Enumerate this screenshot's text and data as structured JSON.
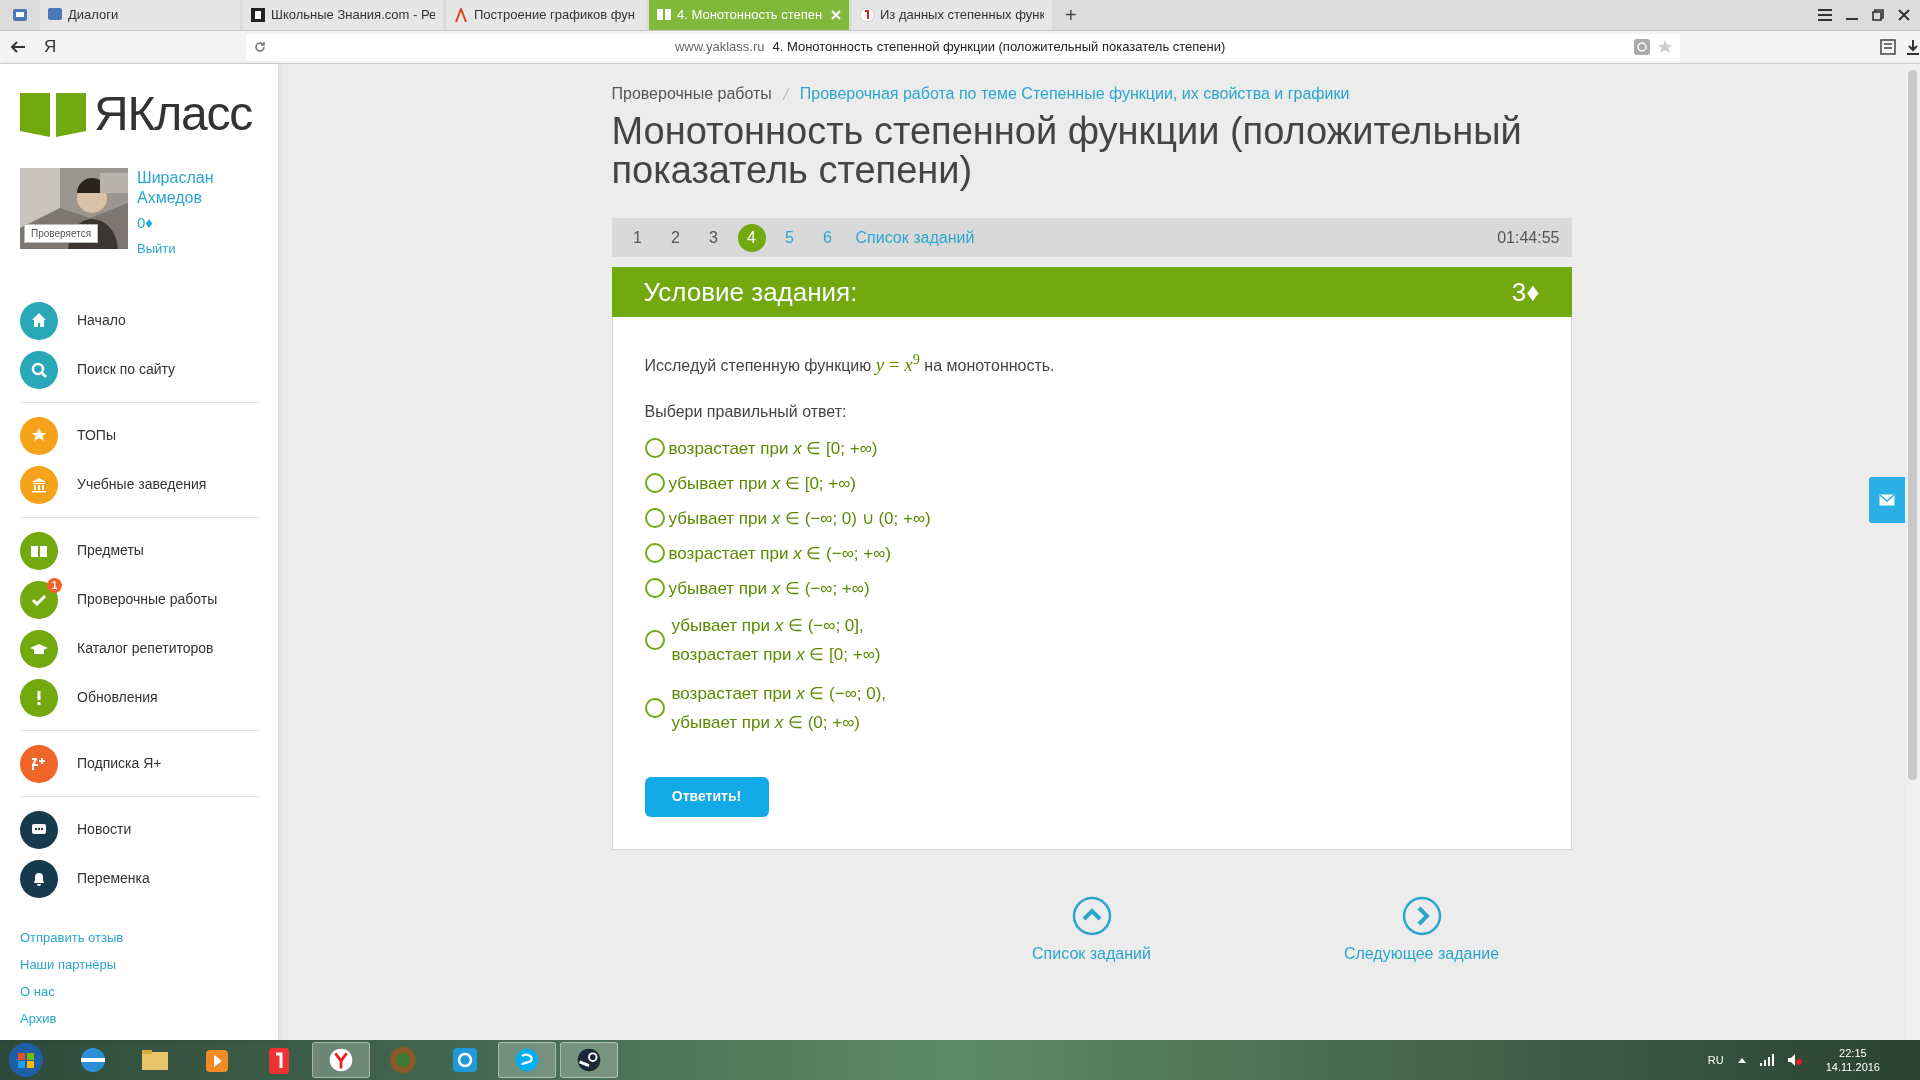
{
  "browser": {
    "tabs": [
      {
        "title": "Диалоги",
        "selected": false
      },
      {
        "title": "Школьные Знания.com - Ре",
        "selected": false
      },
      {
        "title": "Построение графиков фун",
        "selected": false
      },
      {
        "title": "4. Монотонность степен",
        "selected": true
      },
      {
        "title": "Из данных степенных функ",
        "selected": false
      }
    ],
    "new_tab": "+",
    "search_logo": "Я",
    "address_host": "www.yaklass.ru",
    "address_title": "4. Монотонность степенной функции (положительный показатель степени)"
  },
  "sidebar": {
    "logo": "ЯКласс",
    "user": {
      "name": "Шираслан Ахмедов",
      "balance": "0♦",
      "photo_label": "Проверяется",
      "logout": "Выйти"
    },
    "groups": [
      [
        {
          "label": "Начало",
          "color": "#29a8b8"
        },
        {
          "label": "Поиск по сайту",
          "color": "#29a8b8"
        }
      ],
      [
        {
          "label": "ТОПы",
          "color": "#f5a31a"
        },
        {
          "label": "Учебные заведения",
          "color": "#f5a31a"
        }
      ],
      [
        {
          "label": "Предметы",
          "color": "#72a90f"
        },
        {
          "label": "Проверочные работы",
          "color": "#72a90f",
          "badge": "1"
        },
        {
          "label": "Каталог репетиторов",
          "color": "#72a90f"
        },
        {
          "label": "Обновления",
          "color": "#72a90f"
        }
      ],
      [
        {
          "label": "Подписка Я+",
          "color": "#f0642a"
        }
      ],
      [
        {
          "label": "Новости",
          "color": "#173a4f"
        },
        {
          "label": "Переменка",
          "color": "#173a4f"
        }
      ]
    ],
    "footer_links": [
      "Отправить отзыв",
      "Наши партнёры",
      "О нас",
      "Архив"
    ]
  },
  "breadcrumb": [
    "Проверочные работы",
    "Проверочная работа по теме Степенные функции, их свойства и графики"
  ],
  "title": "Монотонность степенной функции (положительный показатель степени)",
  "pager": {
    "pages": [
      {
        "label": "1",
        "selected": false,
        "done": true
      },
      {
        "label": "2",
        "selected": false,
        "done": true
      },
      {
        "label": "3",
        "selected": false,
        "done": true
      },
      {
        "label": "4",
        "selected": true,
        "done": false
      },
      {
        "label": "5",
        "selected": false,
        "done": false
      },
      {
        "label": "6",
        "selected": false,
        "done": false
      }
    ],
    "task_list": "Список заданий",
    "timer": "01:44:55"
  },
  "task": {
    "header": "Условие задания:",
    "points": "3♦",
    "question_before": "Исследуй степенную функцию",
    "question_formula": "*y* = *x*$^{9}$",
    "question_after": "на монотонность.",
    "prompt": "Выбери правильный ответ:",
    "options": [
      {
        "lines": [
          "возрастает при *x* ∈ [0; +∞)"
        ],
        "checked": false
      },
      {
        "lines": [
          "убывает при *x* ∈ [0; +∞)"
        ],
        "checked": false
      },
      {
        "lines": [
          "убывает при *x* ∈ (−∞; 0) ∪ (0; +∞)"
        ],
        "checked": false
      },
      {
        "lines": [
          "возрастает при *x* ∈ (−∞; +∞)"
        ],
        "checked": false
      },
      {
        "lines": [
          "убывает при *x* ∈ (−∞; +∞)"
        ],
        "checked": false
      },
      {
        "lines": [
          "убывает при *x* ∈ (−∞; 0],",
          "возрастает при *x* ∈ [0; +∞)"
        ],
        "checked": false
      },
      {
        "lines": [
          "возрастает при *x* ∈ (−∞; 0),",
          "убывает при *x* ∈ (0; +∞)"
        ],
        "checked": false
      }
    ],
    "submit": "Ответить!"
  },
  "bottom_nav": [
    {
      "label": "Список заданий",
      "kind": "up"
    },
    {
      "label": "Следующее задание",
      "kind": "next"
    }
  ],
  "taskbar": {
    "lang": "RU",
    "time": "22:15",
    "date": "14.11.2016"
  }
}
